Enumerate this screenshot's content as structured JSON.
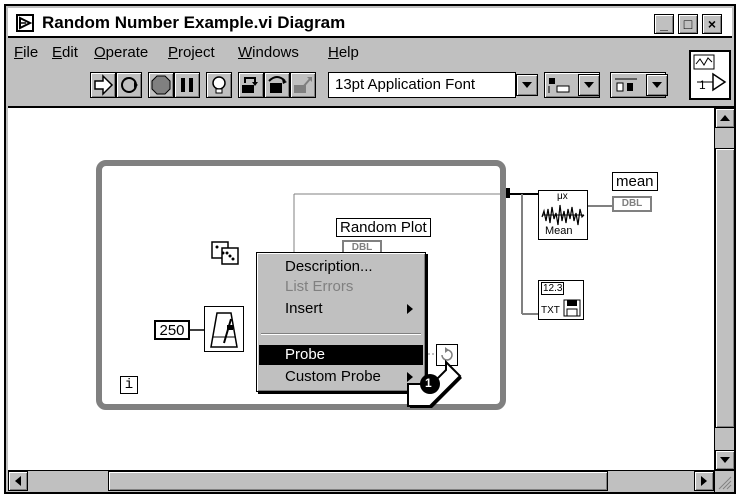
{
  "window": {
    "title": "Random Number Example.vi Diagram",
    "buttons": {
      "minimize": "_",
      "maximize": "□",
      "close": "×"
    }
  },
  "menubar": {
    "items": [
      {
        "label_first": "F",
        "label_rest": "ile"
      },
      {
        "label_first": "E",
        "label_rest": "dit"
      },
      {
        "label_first": "O",
        "label_rest": "perate"
      },
      {
        "label_first": "P",
        "label_rest": "roject"
      },
      {
        "label_first": "W",
        "label_rest": "indows"
      },
      {
        "label_first": "H",
        "label_rest": "elp"
      }
    ]
  },
  "toolbar": {
    "font_select": "13pt Application Font",
    "connector_label": "1"
  },
  "diagram": {
    "iteration_terminal": "i",
    "constant_value": "250",
    "random_plot_label": "Random Plot",
    "random_plot_type": "DBL",
    "mean_label": "mean",
    "mean_type": "DBL",
    "mean_function_label": "Mean",
    "mean_function_symbol": "μx",
    "format_icon_top": "12.3",
    "format_icon_bottom": "TXT"
  },
  "context_menu": {
    "items": [
      {
        "label": "Description...",
        "state": "enabled",
        "submenu": false
      },
      {
        "label": "List Errors",
        "state": "disabled",
        "submenu": false
      },
      {
        "label": "Insert",
        "state": "enabled",
        "submenu": true
      },
      {
        "label": "Probe",
        "state": "selected",
        "submenu": false
      },
      {
        "label": "Custom Probe",
        "state": "enabled",
        "submenu": true
      }
    ]
  },
  "callout": {
    "number": "1"
  }
}
